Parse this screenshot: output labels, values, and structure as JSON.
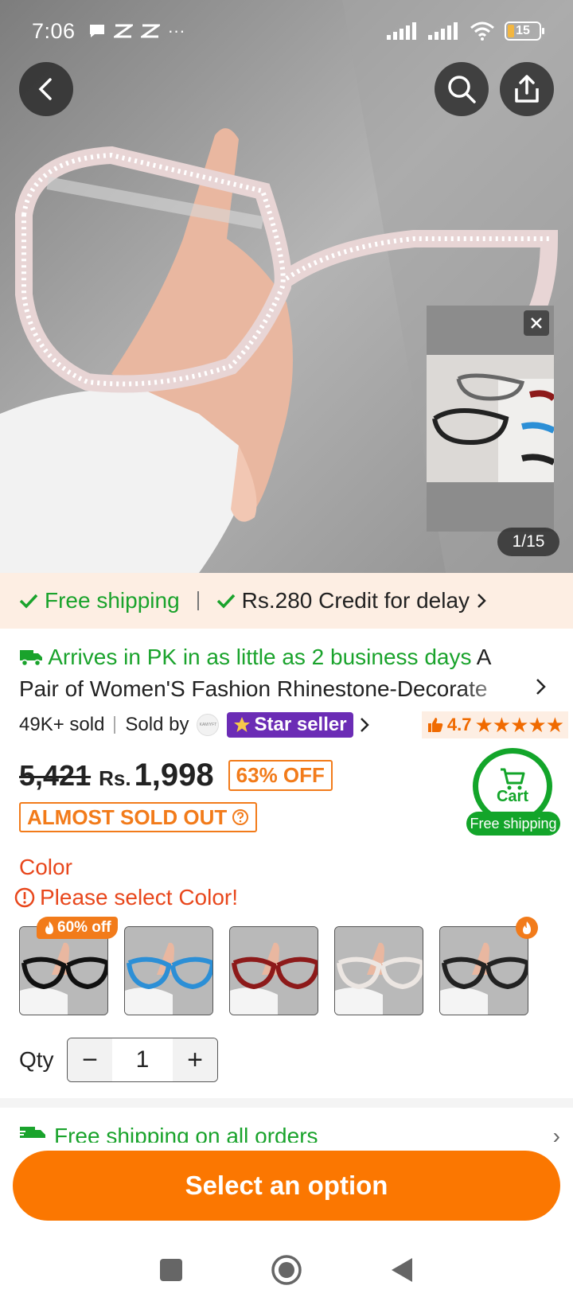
{
  "status_bar": {
    "time": "7:06",
    "battery": "15"
  },
  "gallery": {
    "counter": "1/15"
  },
  "shipping_banner": {
    "free_shipping": "Free shipping",
    "credit": "Rs.280 Credit for delay"
  },
  "product": {
    "arrival": "Arrives in PK in as little as 2 business days",
    "title_start": "A",
    "title_rest": "Pair of Women'S Fashion Rhinestone-Decorate",
    "sold": "49K+ sold",
    "sold_by": "Sold by",
    "store_logo_text": "KAMIYFT",
    "star_seller": "Star seller",
    "rating": "4.7",
    "stars": "★★★★★",
    "old_price": "5,421",
    "currency": "Rs.",
    "price": "1,998",
    "discount": "63% OFF",
    "stock_status": "ALMOST SOLD OUT"
  },
  "cart_button": {
    "label": "Cart",
    "free_shipping": "Free shipping"
  },
  "color": {
    "label": "Color",
    "warning": "Please select Color!",
    "discount_badge": "60% off",
    "swatches": [
      {
        "name": "black-clear",
        "accent": "#111111"
      },
      {
        "name": "blue",
        "accent": "#2c8fd6"
      },
      {
        "name": "red",
        "accent": "#8d1a1a"
      },
      {
        "name": "clear",
        "accent": "#e9e4e1"
      },
      {
        "name": "black-leopard",
        "accent": "#222222"
      }
    ]
  },
  "qty": {
    "label": "Qty",
    "value": "1",
    "minus": "−",
    "plus": "+"
  },
  "shipping_all": "Free shipping on all orders",
  "cta": {
    "label": "Select an option"
  },
  "colors": {
    "brand_orange": "#fb7701",
    "green": "#1aa32c",
    "purple": "#6b2cb5",
    "alert_red": "#e8471c"
  }
}
